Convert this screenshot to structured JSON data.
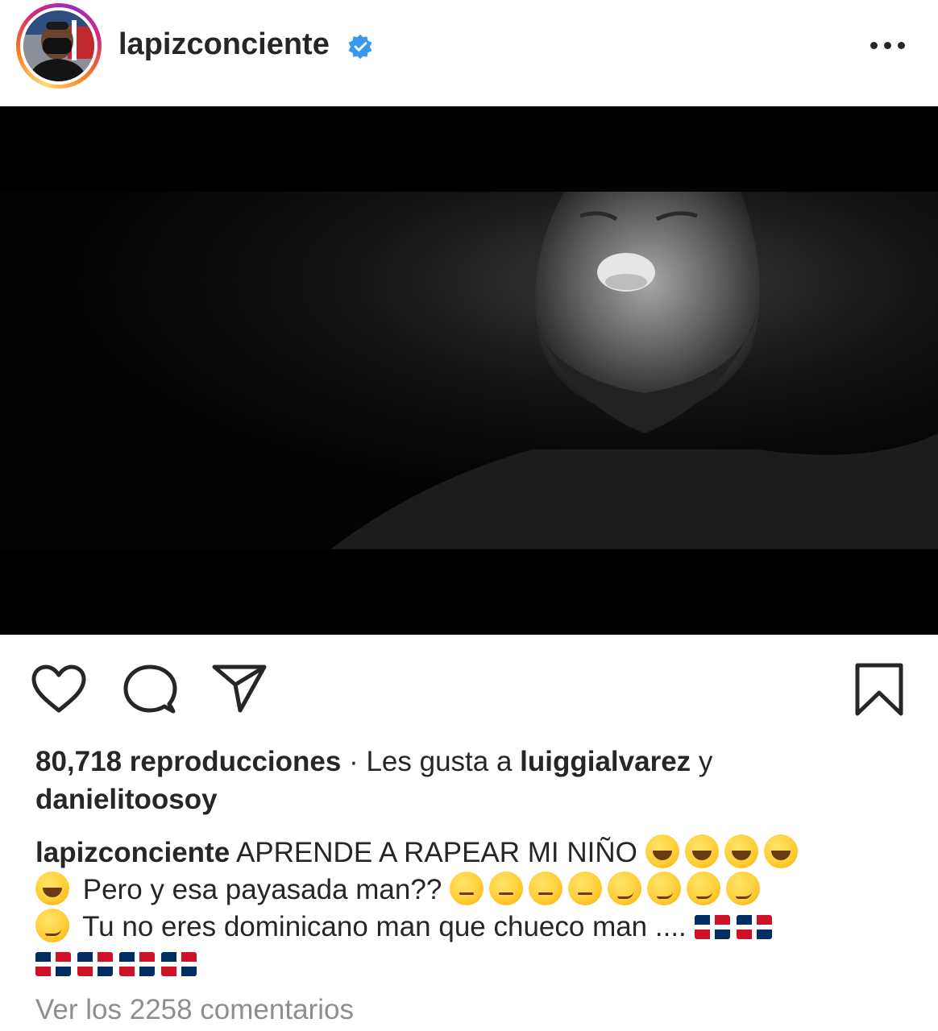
{
  "header": {
    "username": "lapizconciente",
    "verified": true,
    "more_icon": "more-horizontal-icon"
  },
  "media": {
    "type": "video",
    "description_icon": "video-frame"
  },
  "actions": {
    "like_icon": "heart-icon",
    "comment_icon": "comment-icon",
    "share_icon": "send-icon",
    "save_icon": "bookmark-icon"
  },
  "stats": {
    "views": "80,718 reproducciones",
    "separator": " · ",
    "liked_by_prefix": "Les gusta a ",
    "liked_by_user1": "luiggialvarez",
    "liked_by_conj": " y",
    "liked_by_user2": "danielitoosoy"
  },
  "caption": {
    "username": "lapizconciente",
    "line1": " APRENDE A RAPEAR MI NIÑO ",
    "line2": " Pero y esa payasada man?? ",
    "line3": " Tu no eres dominicano man que chueco man .... "
  },
  "comments": {
    "view_all": "Ver los 2258 comentarios"
  },
  "colors": {
    "text": "#262626",
    "muted": "#8e8e8e",
    "verified": "#3897f0"
  }
}
